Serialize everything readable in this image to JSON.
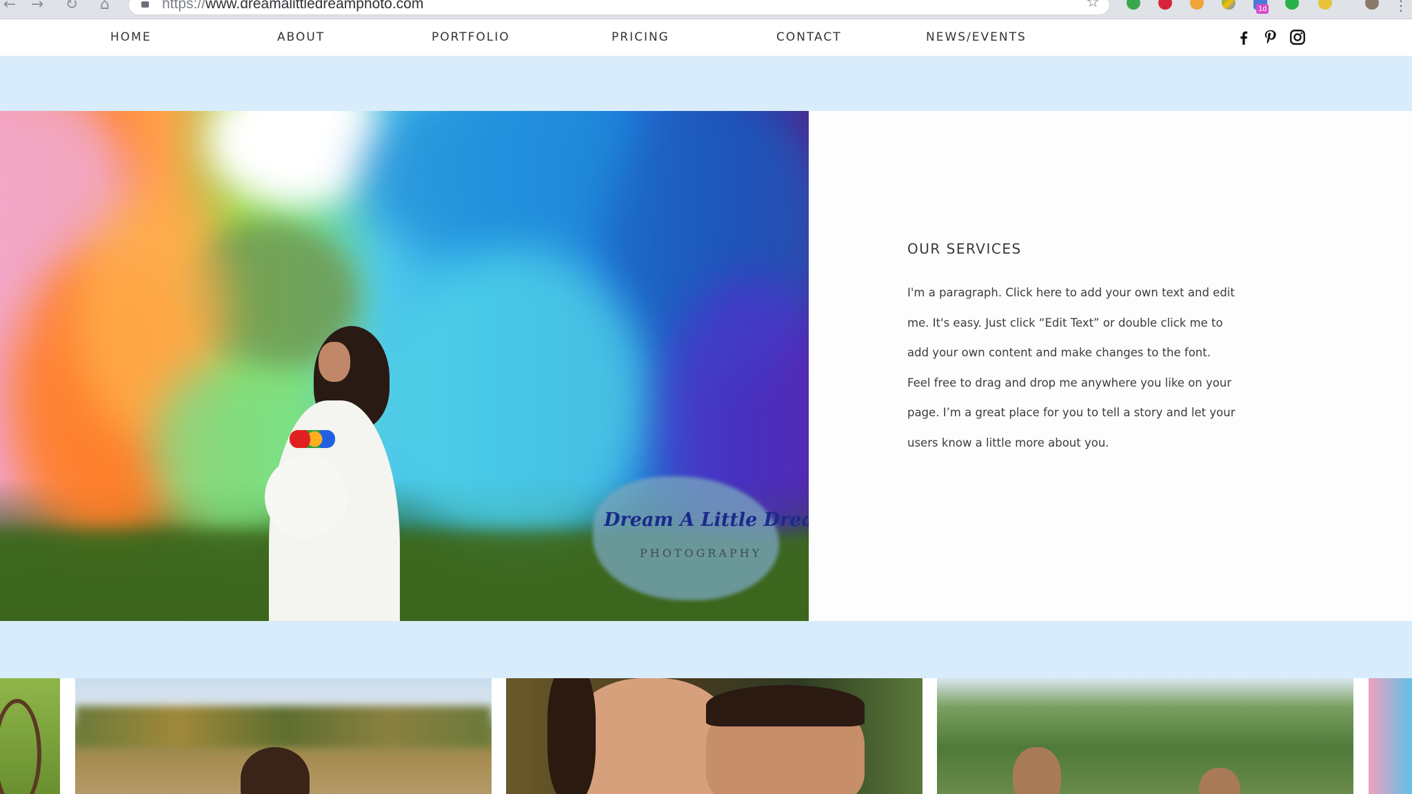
{
  "browser": {
    "url_scheme": "https://",
    "url_host": "www.dreamalittledreamphoto.com",
    "extension_badge": "1d",
    "menu_glyph": "⋮"
  },
  "nav": {
    "items": [
      "HOME",
      "ABOUT",
      "PORTFOLIO",
      "PRICING",
      "CONTACT",
      "NEWS/EVENTS"
    ],
    "social": [
      "facebook-icon",
      "pinterest-icon",
      "instagram-icon"
    ]
  },
  "hero": {
    "watermark_script": "Dream A Little Dream",
    "watermark_sub": "PHOTOGRAPHY"
  },
  "services": {
    "title": "OUR SERVICES",
    "lines": [
      "I'm a paragraph. Click here to add your own text and edit",
      "me. It's easy. Just click “Edit Text” or double click me to",
      "add your own content and make changes to the font.",
      "Feel free to drag and drop me anywhere you like on your",
      "page. I’m a great place for you to tell a story and let your",
      "users know a little more about you."
    ]
  },
  "colors": {
    "band": "#d8ecfb",
    "nav_text": "#333333",
    "panel_bg": "#fdfdfd"
  }
}
